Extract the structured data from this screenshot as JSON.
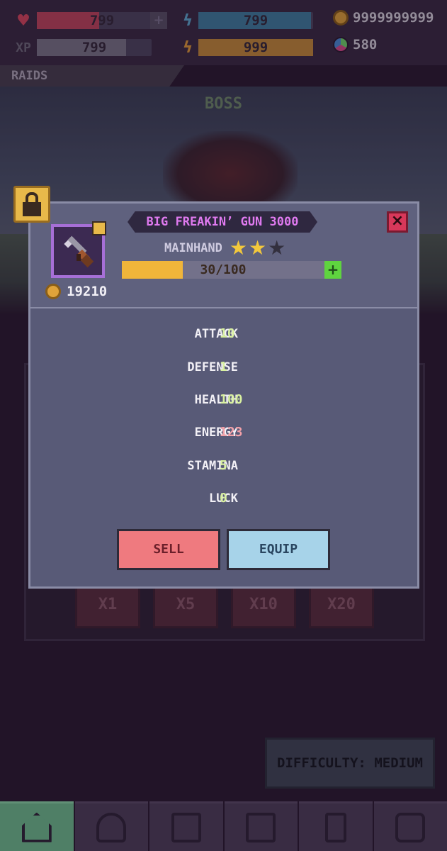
{
  "hud": {
    "health": {
      "icon": "heart-icon",
      "value": "799",
      "color": "#c0455d",
      "fill": 0.48
    },
    "energy": {
      "icon": "lightning-icon",
      "value": "799",
      "color": "#3f7fa0",
      "fill": 0.98
    },
    "coins": {
      "icon": "coin-icon",
      "value": "9999999999"
    },
    "xp": {
      "label": "XP",
      "value": "799",
      "color": "#7a7687",
      "fill": 0.78
    },
    "stamina": {
      "icon": "lightning-orange-icon",
      "value": "999",
      "color": "#c58b3a",
      "fill": 1.0
    },
    "gems": {
      "icon": "gem-icon",
      "value": "580"
    }
  },
  "section": {
    "title": "RAIDS"
  },
  "scene": {
    "title": "BOSS"
  },
  "multipliers": [
    "X1",
    "X5",
    "X10",
    "X20"
  ],
  "difficulty": {
    "label": "DIFFICULTY: MEDIUM"
  },
  "nav": {
    "items": [
      {
        "icon": "home-icon",
        "active": true
      },
      {
        "icon": "profile-icon",
        "active": false
      },
      {
        "icon": "chest-icon",
        "active": false
      },
      {
        "icon": "shop-icon",
        "active": false
      },
      {
        "icon": "flag-icon",
        "active": false
      },
      {
        "icon": "chat-icon",
        "active": false
      }
    ]
  },
  "item": {
    "name": "BIG FREAKIN’ GUN 3000",
    "slot": "MAINHAND",
    "stars": 2,
    "max_stars": 3,
    "xp_text": "30/100",
    "xp_fill": 0.3,
    "price": "19210",
    "icon": "gun-icon",
    "locked": true,
    "stats": [
      {
        "name": "ATTACK",
        "value": "10",
        "color": "#d8f0a0"
      },
      {
        "name": "DEFENSE",
        "value": "1",
        "color": "#d8f0a0"
      },
      {
        "name": "HEALTH",
        "value": "100",
        "color": "#d8f0a0"
      },
      {
        "name": "ENERGY",
        "value": "123",
        "color": "#f2a0a8"
      },
      {
        "name": "STAMINA",
        "value": "5",
        "color": "#d8f0a0"
      },
      {
        "name": "LUCK",
        "value": "0",
        "color": "#d8f0a0"
      }
    ]
  },
  "actions": {
    "sell": "SELL",
    "equip": "EQUIP"
  }
}
